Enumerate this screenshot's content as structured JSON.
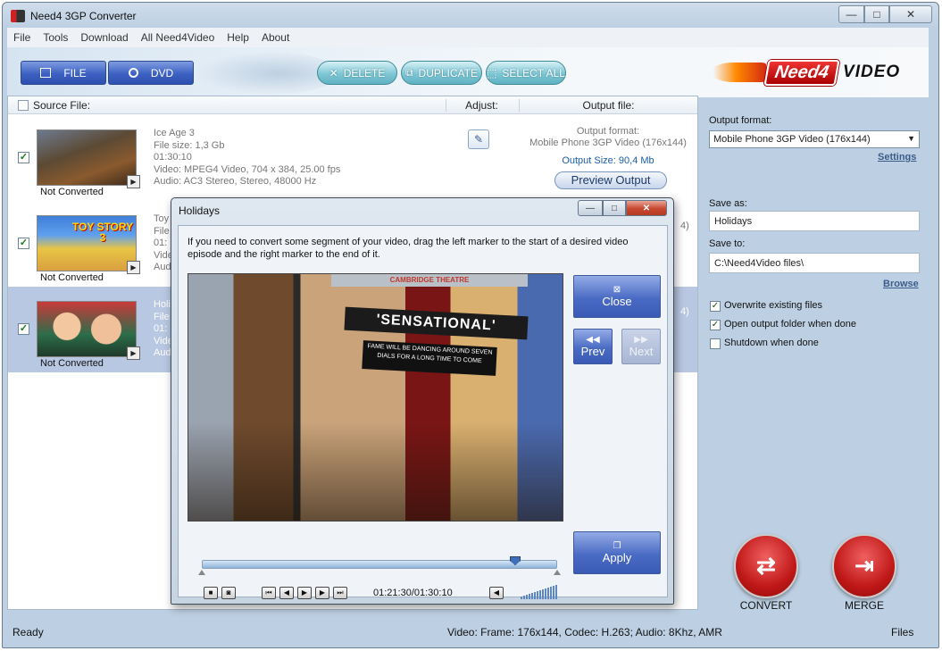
{
  "app": {
    "title": "Need4 3GP Converter",
    "window_controls": {
      "minimize": "—",
      "maximize": "□",
      "close": "✕"
    }
  },
  "menu": [
    "File",
    "Tools",
    "Download",
    "All Need4Video",
    "Help",
    "About"
  ],
  "toolbar": {
    "file_label": "FILE",
    "dvd_label": "DVD",
    "delete_label": "DELETE",
    "duplicate_label": "DUPLICATE",
    "select_all_label": "SELECT ALL",
    "logo_left": "Need4",
    "logo_right": "VIDEO"
  },
  "list": {
    "headers": {
      "source": "Source File:",
      "adjust": "Adjust:",
      "output": "Output file:"
    },
    "rows": [
      {
        "checked": true,
        "status": "Not Converted",
        "info": [
          "Ice Age 3",
          "File size: 1,3 Gb",
          "01:30:10",
          "Video: MPEG4 Video, 704 x 384, 25.00 fps",
          "Audio: AC3 Stereo, Stereo, 48000 Hz"
        ],
        "output_format_label": "Output format:",
        "output_format": "Mobile Phone 3GP Video (176x144)",
        "output_size": "Output Size: 90,4 Mb",
        "preview_label": "Preview Output"
      },
      {
        "checked": true,
        "status": "Not Converted",
        "info": [
          "Toy",
          "File",
          "01:",
          "Vide",
          "Aud"
        ],
        "thumb_text": "TOY STORY 3",
        "partial_right": "4)"
      },
      {
        "checked": true,
        "status": "Not Converted",
        "info": [
          "Holi",
          "File",
          "01:",
          "Vide",
          "Aud"
        ],
        "selected": true,
        "partial_right": "4)"
      }
    ]
  },
  "right_panel": {
    "output_format_label": "Output format:",
    "output_format_value": "Mobile Phone 3GP Video (176x144)",
    "settings_link": "Settings",
    "save_as_label": "Save as:",
    "save_as_value": "Holidays",
    "save_to_label": "Save to:",
    "save_to_value": "C:\\Need4Video files\\",
    "browse_link": "Browse",
    "options": [
      {
        "label": "Overwrite existing files",
        "checked": true
      },
      {
        "label": "Open output folder when done",
        "checked": true
      },
      {
        "label": "Shutdown when done",
        "checked": false
      }
    ],
    "convert_label": "CONVERT",
    "merge_label": "MERGE"
  },
  "statusbar": {
    "ready": "Ready",
    "info": "Video: Frame: 176x144, Codec: H.263; Audio: 8Khz, AMR",
    "files": "Files"
  },
  "dialog": {
    "title": "Holidays",
    "instructions": "If you need to convert some segment of your video, drag the left marker to the start of a desired video episode and the right marker to the end of it.",
    "close_label": "Close",
    "prev_label": "Prev",
    "next_label": "Next",
    "apply_label": "Apply",
    "time": "01:21:30/01:30:10",
    "video_sign": "'SENSATIONAL'",
    "video_top_sign": "CAMBRIDGE THEATRE",
    "video_marquee": "FAME WILL BE DANCING AROUND SEVEN DIALS FOR A LONG TIME TO COME",
    "position_fraction": 0.9,
    "volume_fraction": 1.0
  }
}
